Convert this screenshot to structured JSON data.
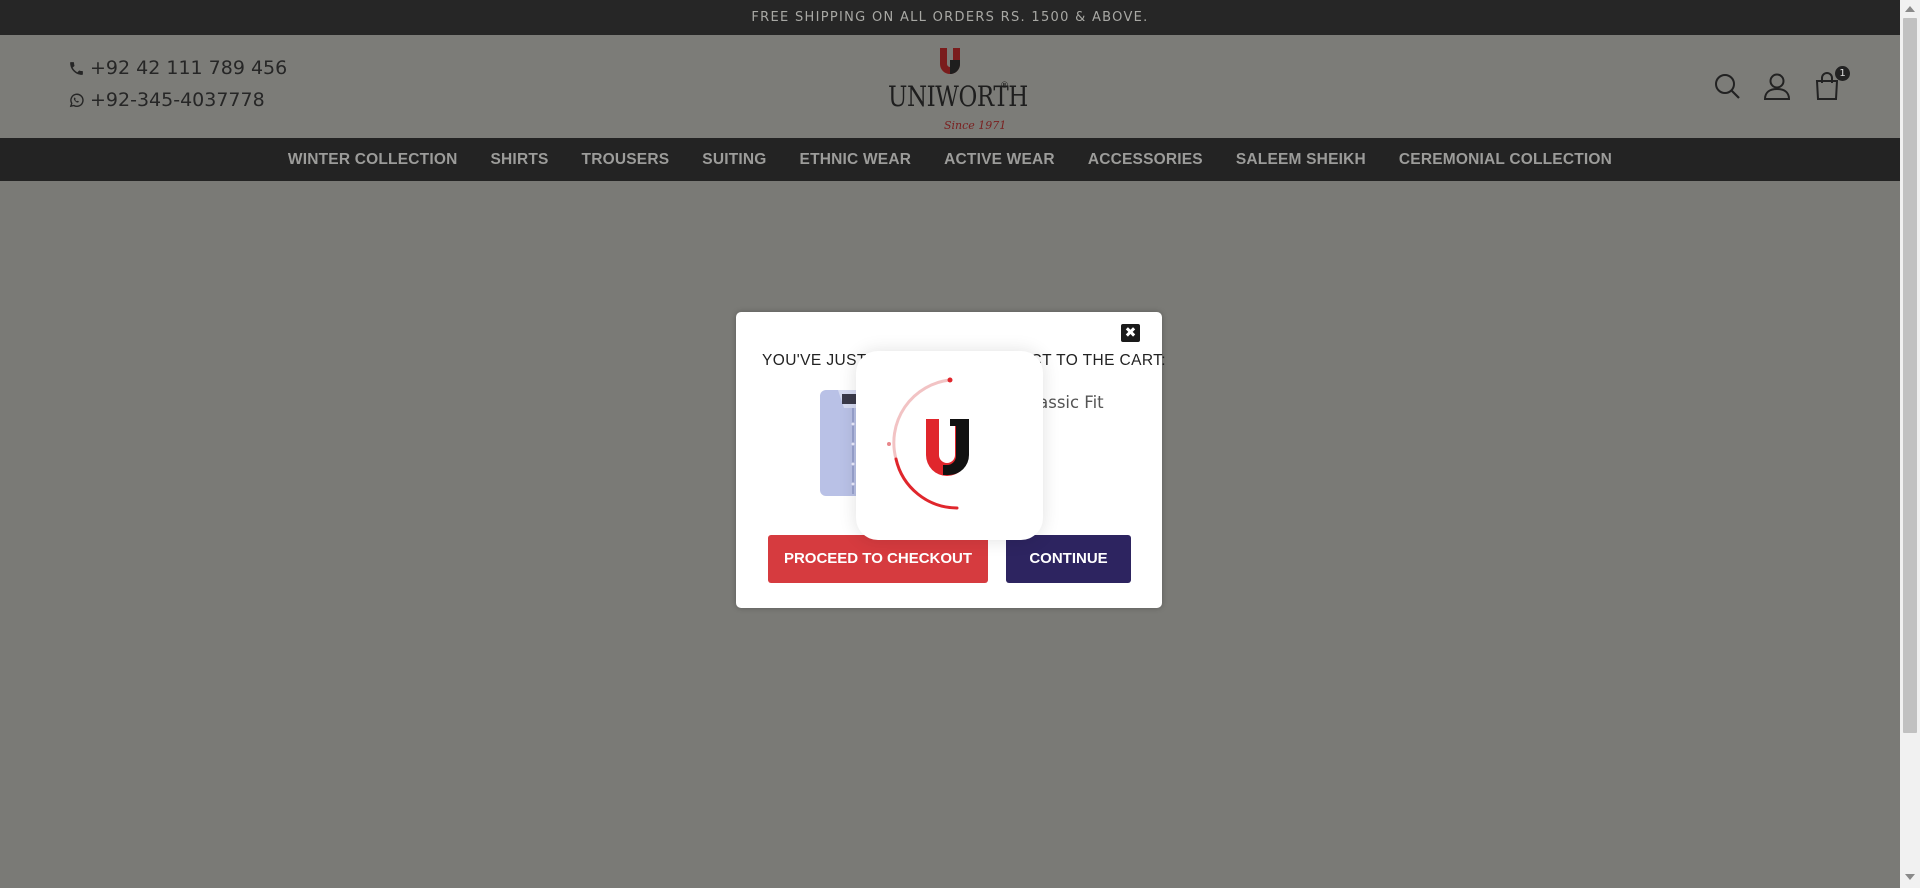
{
  "announcement": "FREE SHIPPING ON ALL ORDERS RS. 1500 & ABOVE.",
  "contact": {
    "phone": "+92 42 111 789 456",
    "whatsapp": "+92-345-4037778",
    "phone_icon": "phone-icon",
    "whatsapp_icon": "whatsapp-icon"
  },
  "logo": {
    "letter": "U",
    "brand": "UNIWORTH",
    "registered": "®",
    "tagline": "Since 1971"
  },
  "header_icons": {
    "search": "search-icon",
    "account": "user-icon",
    "cart": "shopping-bag-icon",
    "cart_count": "1"
  },
  "nav": {
    "items": [
      {
        "label": "WINTER COLLECTION"
      },
      {
        "label": "SHIRTS"
      },
      {
        "label": "TROUSERS"
      },
      {
        "label": "SUITING"
      },
      {
        "label": "ETHNIC WEAR"
      },
      {
        "label": "ACTIVE WEAR"
      },
      {
        "label": "ACCESSORIES"
      },
      {
        "label": "SALEEM SHEIKH"
      },
      {
        "label": "CEREMONIAL COLLECTION"
      }
    ]
  },
  "modal": {
    "close_label": "✖",
    "heading": "YOU'VE JUST ADDED THIS PRODUCT TO THE CART:",
    "product_name": "Classic Fit",
    "checkout_label": "PROCEED TO CHECKOUT",
    "continue_label": "CONTINUE"
  },
  "colors": {
    "announce_bg": "#262626",
    "nav_bg": "#232323",
    "overlay": "#7a7a76",
    "checkout_btn": "#d63b3f",
    "continue_btn": "#2d2460",
    "brand_red": "#e0262c"
  }
}
